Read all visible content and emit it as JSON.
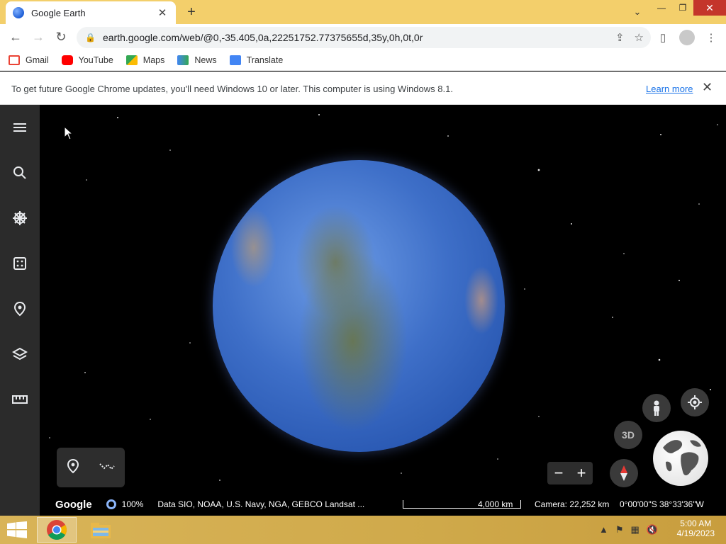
{
  "browser": {
    "tab_title": "Google Earth",
    "new_tab": "+",
    "url": "earth.google.com/web/@0,-35.405,0a,22251752.77375655d,35y,0h,0t,0r",
    "bookmarks": [
      {
        "label": "Gmail",
        "color": "#ea4335"
      },
      {
        "label": "YouTube",
        "color": "#ff0000"
      },
      {
        "label": "Maps",
        "color": "#34a853"
      },
      {
        "label": "News",
        "color": "#4285f4"
      },
      {
        "label": "Translate",
        "color": "#4285f4"
      }
    ],
    "infobar": {
      "message": "To get future Google Chrome updates, you'll need Windows 10 or later. This computer is using Windows 8.1.",
      "link": "Learn more"
    }
  },
  "earth": {
    "sidebar_items": [
      "menu-icon",
      "search-icon",
      "voyager-icon",
      "feeling-lucky-icon",
      "projects-icon",
      "map-style-icon",
      "measure-icon"
    ],
    "footer": {
      "brand": "Google",
      "percent": "100%",
      "attribution": "Data SIO, NOAA, U.S. Navy, NGA, GEBCO  Landsat ...",
      "scale": "4,000 km",
      "camera": "Camera: 22,252 km",
      "coords": "0°00'00\"S 38°33'36\"W"
    },
    "controls": {
      "three_d": "3D",
      "zoom_out": "−",
      "zoom_in": "+"
    }
  },
  "taskbar": {
    "time": "5:00 AM",
    "date": "4/19/2023"
  }
}
